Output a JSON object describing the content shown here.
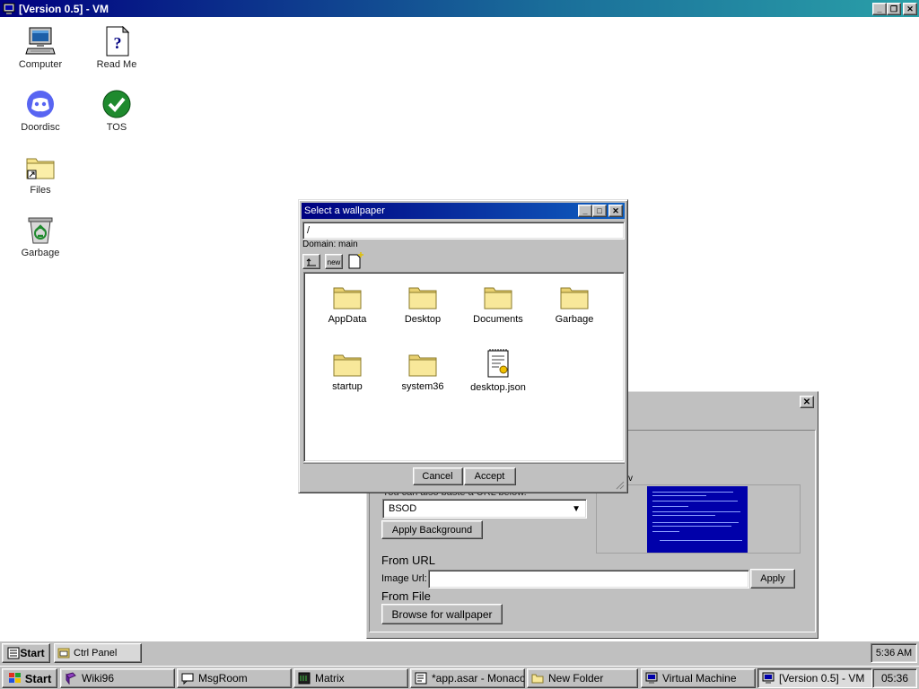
{
  "vm_window": {
    "title": "[Version 0.5] - VM",
    "minimize": "_",
    "restore": "❐",
    "close": "✕"
  },
  "desktop": {
    "icons": [
      {
        "label": "Computer",
        "icon": "computer-icon"
      },
      {
        "label": "Read Me",
        "icon": "readme-icon"
      },
      {
        "label": "Doordisc",
        "icon": "discord-icon"
      },
      {
        "label": "TOS",
        "icon": "checkmark-icon"
      },
      {
        "label": "Files",
        "icon": "folder-shortcut-icon"
      },
      {
        "label": "Garbage",
        "icon": "recycle-bin-icon"
      }
    ]
  },
  "ctrl_panel": {
    "close": "✕",
    "url_hint": "You can also paste a URL below.",
    "preview_label": "v",
    "select_value": "BSOD",
    "apply_background": "Apply Background",
    "from_url_heading": "From URL",
    "image_url_label": "Image Url:",
    "image_url_value": "",
    "apply": "Apply",
    "from_file_heading": "From File",
    "browse": "Browse for wallpaper"
  },
  "wallpaper_dialog": {
    "title": "Select a wallpaper",
    "path": "/",
    "domain": "Domain: main",
    "toolbar": {
      "up": "up",
      "new_folder": "new",
      "new_file": "new-file"
    },
    "files": [
      {
        "name": "AppData",
        "type": "folder"
      },
      {
        "name": "Desktop",
        "type": "folder"
      },
      {
        "name": "Documents",
        "type": "folder"
      },
      {
        "name": "Garbage",
        "type": "folder"
      },
      {
        "name": "startup",
        "type": "folder"
      },
      {
        "name": "system36",
        "type": "folder"
      },
      {
        "name": "desktop.json",
        "type": "file"
      }
    ],
    "cancel": "Cancel",
    "accept": "Accept"
  },
  "inner_taskbar": {
    "start": "Start",
    "tasks": [
      {
        "label": "Ctrl Panel"
      }
    ],
    "clock": "5:36 AM"
  },
  "host_taskbar": {
    "start": "Start",
    "tasks": [
      {
        "label": "Wiki96"
      },
      {
        "label": "MsgRoom"
      },
      {
        "label": "Matrix"
      },
      {
        "label": "*app.asar - Monaco"
      },
      {
        "label": "New Folder"
      },
      {
        "label": "Virtual Machine"
      },
      {
        "label": "[Version 0.5] - VM"
      }
    ],
    "clock": "05:36"
  },
  "colors": {
    "titlebar_active": "#000080",
    "face": "#c0c0c0",
    "preview_blue": "#0000aa",
    "folder_yellow": "#f6e38a"
  }
}
